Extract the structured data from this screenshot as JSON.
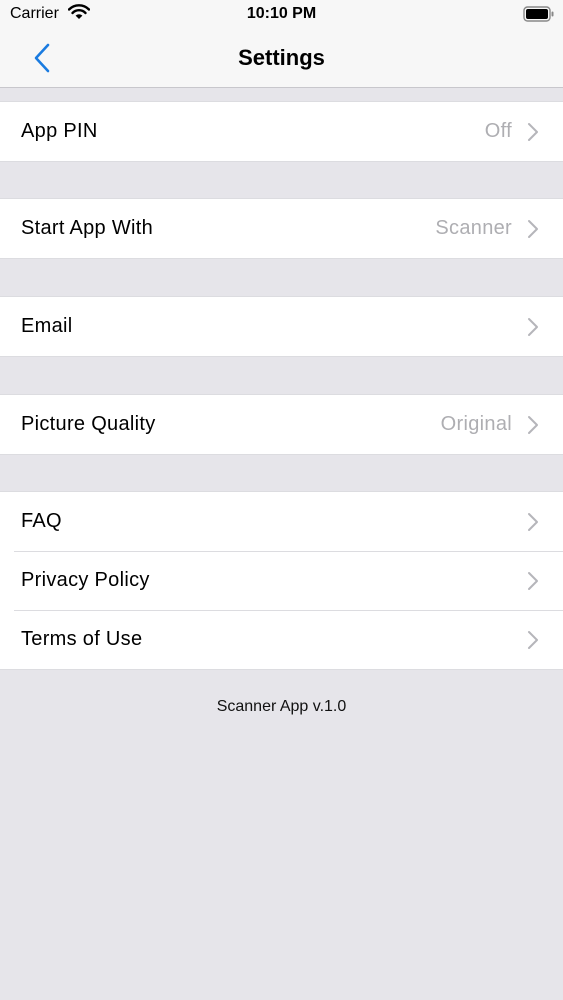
{
  "status_bar": {
    "carrier": "Carrier",
    "time": "10:10 PM"
  },
  "nav": {
    "title": "Settings",
    "back_icon": "chevron-left-icon"
  },
  "groups": [
    {
      "rows": [
        {
          "label": "App PIN",
          "value": "Off"
        }
      ]
    },
    {
      "rows": [
        {
          "label": "Start App With",
          "value": "Scanner"
        }
      ]
    },
    {
      "rows": [
        {
          "label": "Email",
          "value": ""
        }
      ]
    },
    {
      "rows": [
        {
          "label": "Picture Quality",
          "value": "Original"
        }
      ]
    },
    {
      "rows": [
        {
          "label": "FAQ",
          "value": ""
        },
        {
          "label": "Privacy Policy",
          "value": ""
        },
        {
          "label": "Terms of Use",
          "value": ""
        }
      ]
    }
  ],
  "footer": {
    "version_text": "Scanner App v.1.0"
  },
  "colors": {
    "background": "#e6e5ea",
    "accent": "#1a7be0",
    "secondary_text": "#aeaeb2",
    "chevron": "#b5b5ba"
  }
}
